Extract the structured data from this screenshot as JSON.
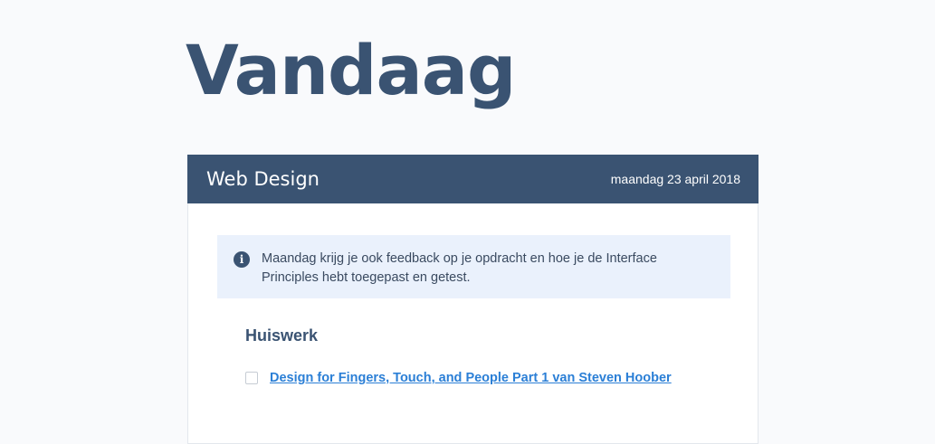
{
  "page": {
    "title": "Vandaag"
  },
  "course": {
    "title": "Web Design",
    "date": "maandag 23 april 2018"
  },
  "notice": {
    "icon": "info-icon",
    "text": "Maandag krijg je ook feedback op je opdracht en hoe je de Interface Principles hebt toegepast en getest."
  },
  "homework": {
    "heading": "Huiswerk",
    "items": [
      {
        "label": "Design for Fingers, Touch, and People Part 1 van Steven Hoober",
        "checked": false
      }
    ]
  },
  "colors": {
    "primary": "#3a5372",
    "notice_bg": "#eaf1fc",
    "link": "#2b7fd6",
    "page_bg": "#f9fafc"
  }
}
